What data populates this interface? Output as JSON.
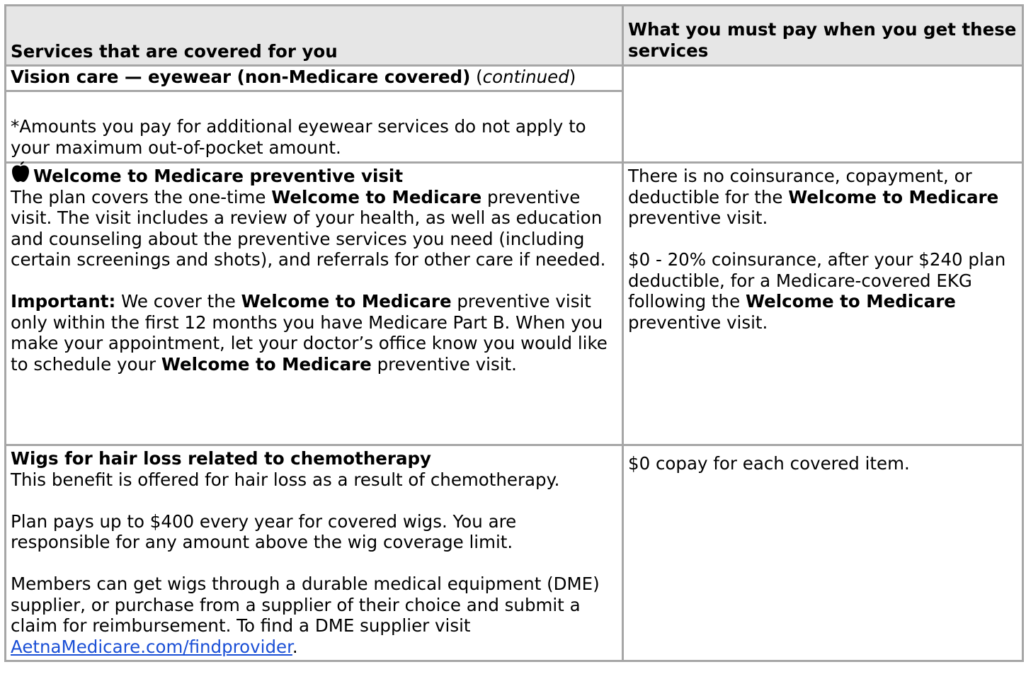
{
  "table": {
    "headers": {
      "left": "Services that are covered for you",
      "right": "What you must pay when you get these services"
    },
    "vision": {
      "title": "Vision care — eyewear (non-Medicare covered)",
      "title_suffix_open": " (",
      "continued": "continued",
      "title_suffix_close": ")",
      "note": "*Amounts you pay for additional eyewear services do not apply to your maximum out-of-pocket amount."
    },
    "welcome": {
      "icon": "apple-icon",
      "title": "Welcome to Medicare preventive visit",
      "p1_a": "The plan covers the one-time ",
      "p1_b": "Welcome to Medicare",
      "p1_c": " preventive visit. The visit includes a review of your health, as well as education and counseling about the preventive services you need (including certain screenings and shots), and referrals for other care if needed.",
      "p2_label": "Important:",
      "p2_a": " We cover the ",
      "p2_b": "Welcome to Medicare",
      "p2_c": " preventive visit only within the first 12 months you have Medicare Part B. When you make your appointment, let your doctor’s office know you would like to schedule your ",
      "p2_d": "Welcome to Medicare",
      "p2_e": " preventive visit.",
      "pay1_a": "There is no coinsurance, copayment, or deductible for the ",
      "pay1_b": "Welcome to Medicare",
      "pay1_c": " preventive visit.",
      "pay2_a": "$0 - 20% coinsurance, after your $240 plan deductible, for a Medicare-covered EKG following the ",
      "pay2_b": "Welcome to Medicare",
      "pay2_c": " preventive visit."
    },
    "wigs": {
      "title": "Wigs for hair loss related to chemotherapy",
      "p1": "This benefit is offered for hair loss as a result of chemotherapy.",
      "p2": "Plan pays up to $400 every year for covered wigs. You are responsible for any amount above the wig coverage limit.",
      "p3": "Members can get wigs through a durable medical equipment (DME) supplier, or purchase from a supplier of their choice and submit a claim for reimbursement. To find a DME supplier visit ",
      "link": "AetnaMedicare.com/findprovider",
      "p3_end": ".",
      "pay": "$0 copay for each covered item."
    }
  },
  "colors": {
    "border": "#a6a6a6",
    "header_bg": "#e6e6e6",
    "link": "#1a4fd6",
    "text": "#000000"
  }
}
